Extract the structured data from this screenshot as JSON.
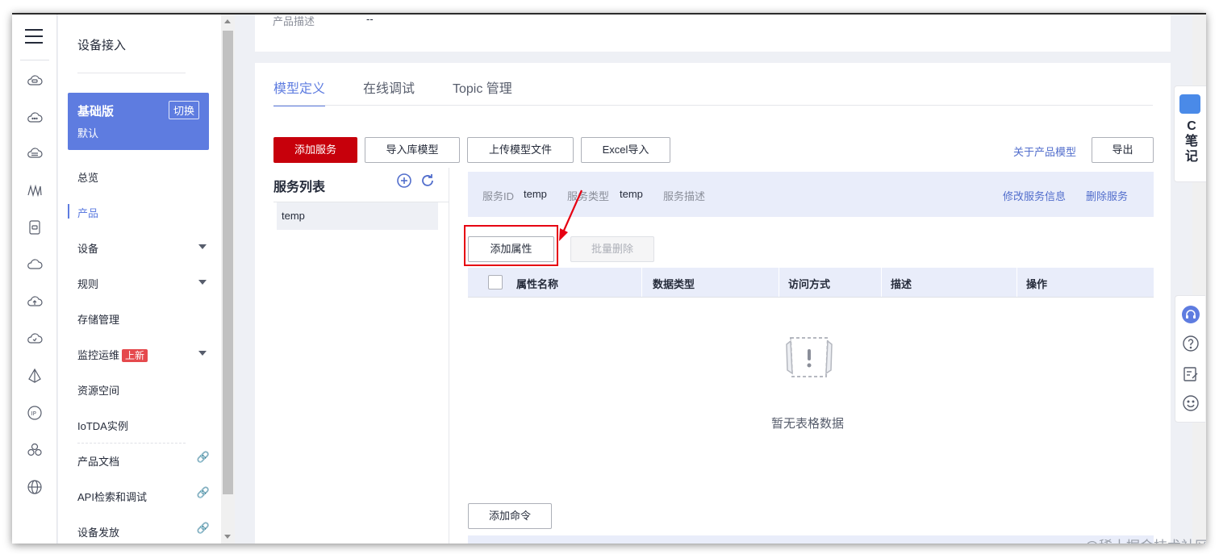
{
  "sidebar": {
    "title": "设备接入",
    "edition": {
      "name": "基础版",
      "sub": "默认",
      "switch_label": "切换"
    },
    "items": [
      {
        "label": "总览"
      },
      {
        "label": "产品"
      },
      {
        "label": "设备"
      },
      {
        "label": "规则"
      },
      {
        "label": "存储管理"
      },
      {
        "label": "监控运维",
        "badge": "上新"
      },
      {
        "label": "资源空间"
      },
      {
        "label": "IoTDA实例"
      },
      {
        "label": "产品文档"
      },
      {
        "label": "API检索和调试"
      },
      {
        "label": "设备发放"
      }
    ]
  },
  "rail_icons": [
    "cloud-service-icon",
    "cloud-icon",
    "database-cloud-icon",
    "wave-icon",
    "device-icon",
    "cloud-outline-icon",
    "upload-cloud-icon",
    "monitor-cloud-icon",
    "pyramid-icon",
    "ip-icon",
    "cluster-icon",
    "globe-icon"
  ],
  "top_card": {
    "label": "产品描述",
    "value": "--"
  },
  "tabs": [
    {
      "label": "模型定义",
      "active": true
    },
    {
      "label": "在线调试",
      "active": false
    },
    {
      "label": "Topic 管理",
      "active": false
    }
  ],
  "toolbar": {
    "add_service": "添加服务",
    "import_model": "导入库模型",
    "upload_model": "上传模型文件",
    "excel_import": "Excel导入",
    "about_model": "关于产品模型",
    "export": "导出"
  },
  "service_list": {
    "title": "服务列表",
    "items": [
      "temp"
    ]
  },
  "service_info": {
    "id_label": "服务ID",
    "id_value": "temp",
    "type_label": "服务类型",
    "type_value": "temp",
    "desc_label": "服务描述",
    "edit_link": "修改服务信息",
    "delete_link": "删除服务"
  },
  "property_actions": {
    "add_property": "添加属性",
    "batch_delete": "批量删除"
  },
  "table": {
    "columns": [
      "属性名称",
      "数据类型",
      "访问方式",
      "描述",
      "操作"
    ],
    "empty_text": "暂无表格数据"
  },
  "add_command": "添加命令",
  "float_note": {
    "text": "C笔记"
  },
  "float_tools": [
    "headset-icon",
    "help-icon",
    "edit-note-icon",
    "smile-icon"
  ],
  "watermark": "@稀土掘金技术社区",
  "colors": {
    "brand_red": "#c7000b",
    "accent_blue": "#5e7ce0",
    "highlight_red": "#e60012"
  }
}
